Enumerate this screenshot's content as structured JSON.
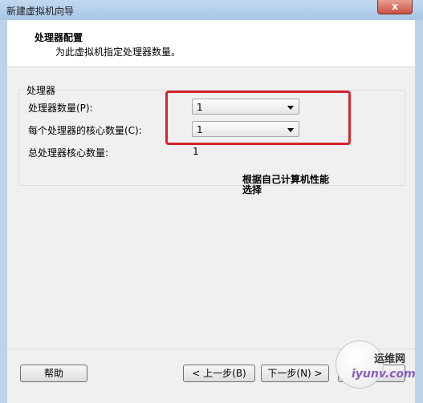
{
  "window": {
    "title": "新建虚拟机向导",
    "close_label": "x"
  },
  "header": {
    "title": "处理器配置",
    "subtitle": "为此虚拟机指定处理器数量。"
  },
  "group": {
    "title": "处理器",
    "processors": {
      "label": "处理器数量(P):",
      "value": "1"
    },
    "cores": {
      "label": "每个处理器的核心数量(C):",
      "value": "1"
    },
    "total": {
      "label": "总处理器核心数量:",
      "value": "1"
    }
  },
  "annotation": {
    "line1": "根据自己计算机性能",
    "line2": "选择"
  },
  "buttons": {
    "help": "帮助",
    "back": "< 上一步(B)",
    "next": "下一步(N) >",
    "cancel": "取消"
  },
  "watermark": {
    "site_name": "运维网",
    "url": "iyunv.com"
  },
  "colors": {
    "highlight": "#d8232a",
    "title_bar": "#b8d0ec"
  }
}
